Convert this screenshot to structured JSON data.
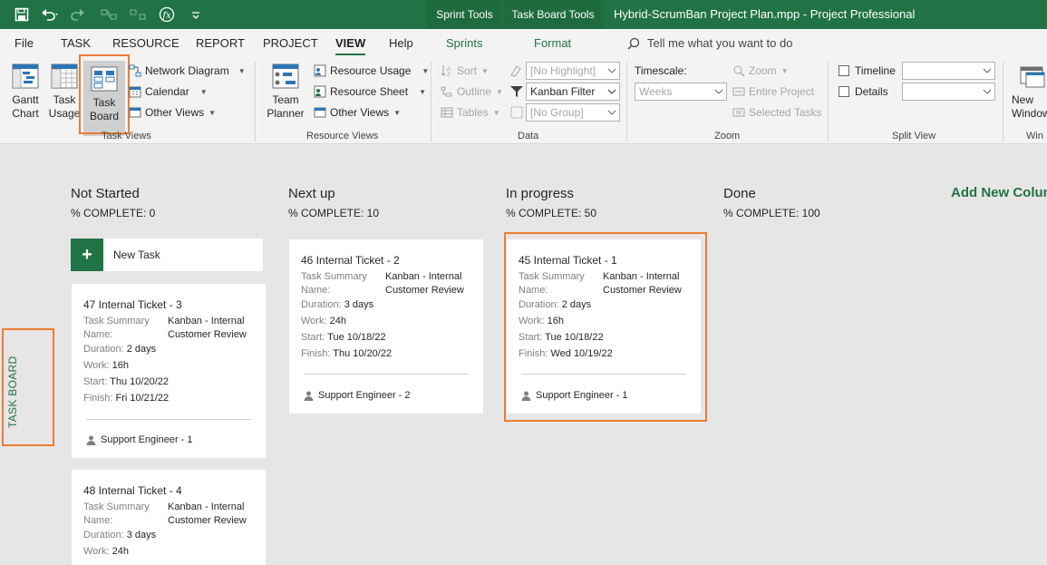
{
  "titlebar": {
    "context_tabs": [
      "Sprint Tools",
      "Task Board Tools"
    ],
    "document_title": "Hybrid-ScrumBan Project Plan.mpp  -  Project Professional"
  },
  "ribbon_tabs": [
    {
      "label": "File"
    },
    {
      "label": "TASK"
    },
    {
      "label": "RESOURCE"
    },
    {
      "label": "REPORT"
    },
    {
      "label": "PROJECT"
    },
    {
      "label": "VIEW",
      "active": true
    },
    {
      "label": "Help"
    },
    {
      "label": "Sprints",
      "contextual": true
    },
    {
      "label": "Format",
      "contextual": true
    }
  ],
  "tell_me": "Tell me what you want to do",
  "groups": {
    "task_views": {
      "label": "Task Views",
      "gantt": "Gantt\nChart",
      "task_usage": "Task\nUsage",
      "task_board": "Task\nBoard",
      "network_diagram": "Network Diagram",
      "calendar": "Calendar",
      "other_views": "Other Views"
    },
    "resource_views": {
      "label": "Resource Views",
      "team_planner": "Team\nPlanner",
      "resource_usage": "Resource Usage",
      "resource_sheet": "Resource Sheet",
      "other_views": "Other Views"
    },
    "data": {
      "label": "Data",
      "sort": "Sort",
      "outline": "Outline",
      "tables": "Tables",
      "highlight": "[No Highlight]",
      "filter": "Kanban Filter",
      "group": "[No Group]"
    },
    "zoom": {
      "label": "Zoom",
      "timescale_label": "Timescale:",
      "timescale_value": "Weeks",
      "zoom": "Zoom",
      "entire_project": "Entire Project",
      "selected_tasks": "Selected Tasks"
    },
    "split_view": {
      "label": "Split View",
      "timeline": "Timeline",
      "details": "Details"
    },
    "window": {
      "label": "Win",
      "new_window": "New\nWindow"
    }
  },
  "board": {
    "side_tab": "TASK BOARD",
    "add_column": "Add New Column",
    "new_task": "New Task",
    "columns": [
      {
        "title": "Not Started",
        "pct": "% COMPLETE: 0"
      },
      {
        "title": "Next up",
        "pct": "% COMPLETE: 10"
      },
      {
        "title": "In progress",
        "pct": "% COMPLETE: 50"
      },
      {
        "title": "Done",
        "pct": "% COMPLETE: 100"
      }
    ],
    "card_labels": {
      "summary": "Task Summary\nName:",
      "duration": "Duration:",
      "work": "Work:",
      "start": "Start:",
      "finish": "Finish:"
    },
    "cards": [
      {
        "title": "47 Internal Ticket - 3",
        "summary": "Kanban - Internal\nCustomer Review",
        "duration": "2 days",
        "work": "16h",
        "start": "Thu 10/20/22",
        "finish": "Fri 10/21/22",
        "resource": "Support Engineer - 1"
      },
      {
        "title": "48 Internal Ticket - 4",
        "summary": "Kanban - Internal\nCustomer Review",
        "duration": "3 days",
        "work": "24h"
      },
      {
        "title": "46 Internal Ticket - 2",
        "summary": "Kanban - Internal\nCustomer Review",
        "duration": "3 days",
        "work": "24h",
        "start": "Tue 10/18/22",
        "finish": "Thu 10/20/22",
        "resource": "Support Engineer - 2"
      },
      {
        "title": "45 Internal Ticket - 1",
        "summary": "Kanban - Internal\nCustomer Review",
        "duration": "2 days",
        "work": "16h",
        "start": "Tue 10/18/22",
        "finish": "Wed 10/19/22",
        "resource": "Support Engineer - 1"
      }
    ]
  }
}
